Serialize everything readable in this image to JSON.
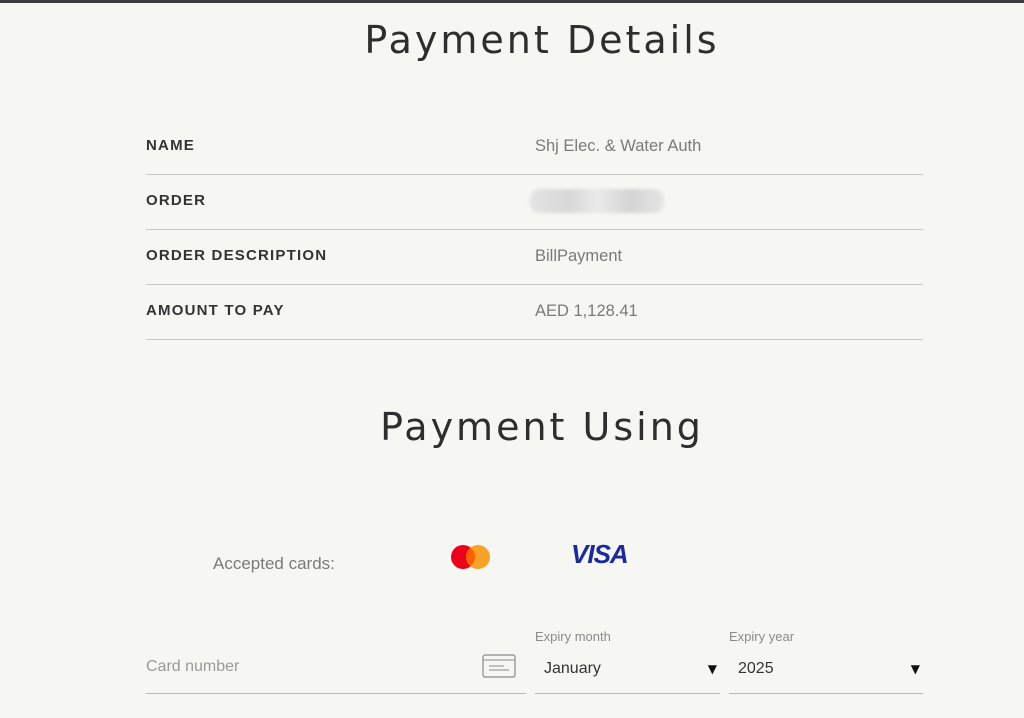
{
  "payment_details": {
    "title": "Payment Details",
    "rows": [
      {
        "label": "NAME",
        "value": "Shj Elec. & Water Auth"
      },
      {
        "label": "ORDER",
        "value": ""
      },
      {
        "label": "ORDER DESCRIPTION",
        "value": "BillPayment"
      },
      {
        "label": "AMOUNT TO PAY",
        "value": "AED 1,128.41"
      }
    ]
  },
  "payment_using": {
    "title": "Payment Using",
    "accepted_cards_label": "Accepted cards:",
    "cards": [
      {
        "name": "mastercard",
        "icon": "mastercard-logo",
        "colors": [
          "#eb001b",
          "#f79e1b"
        ]
      },
      {
        "name": "visa",
        "label": "VISA",
        "color": "#1a2a9c"
      }
    ],
    "card_number": {
      "placeholder": "Card number",
      "value": "",
      "icon": "card-icon"
    },
    "expiry_month": {
      "caption": "Expiry month",
      "value": "January"
    },
    "expiry_year": {
      "caption": "Expiry year",
      "value": "2025"
    }
  }
}
